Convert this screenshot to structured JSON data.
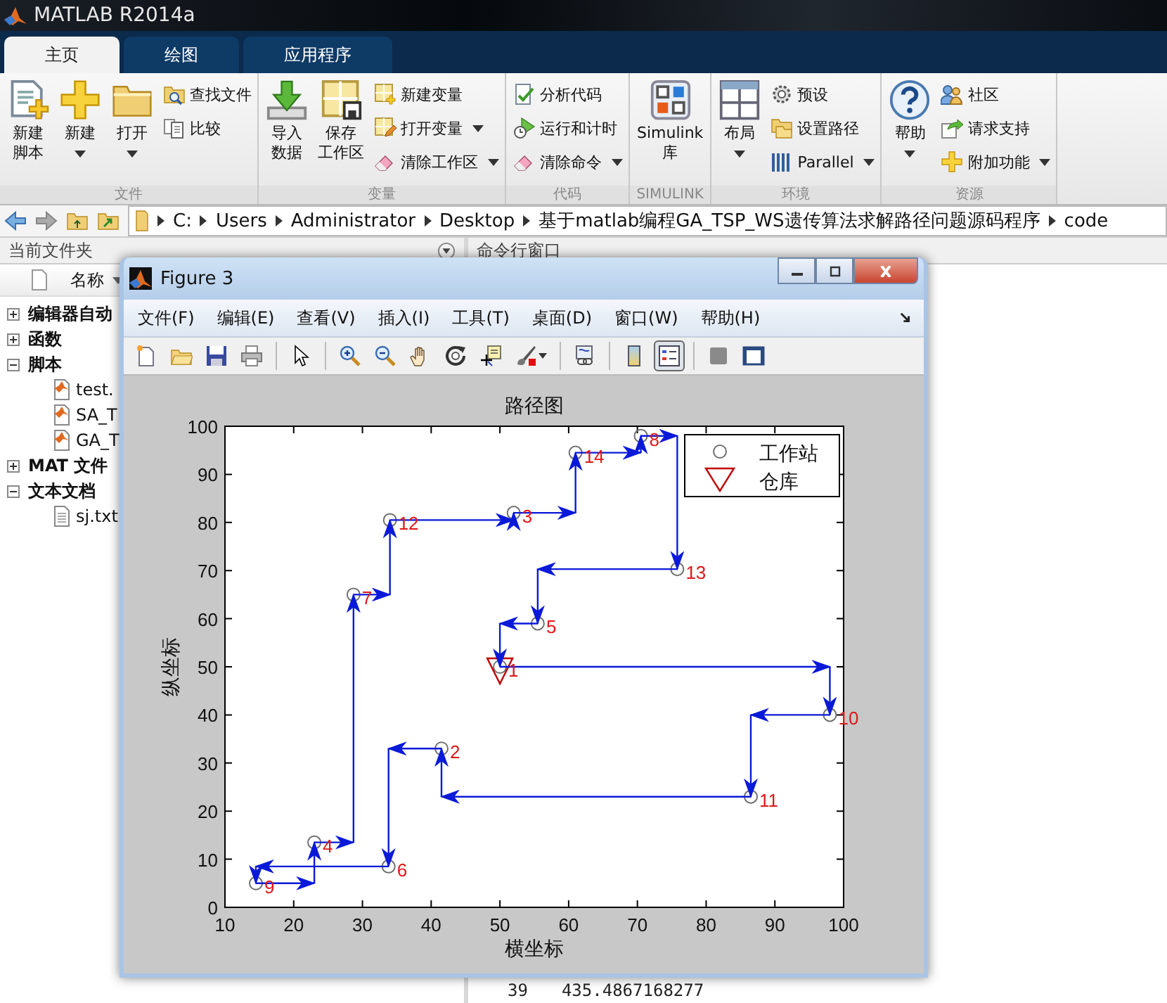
{
  "window": {
    "title": "MATLAB R2014a"
  },
  "ribbon_tabs": [
    {
      "label": "主页",
      "selected": true
    },
    {
      "label": "绘图",
      "selected": false
    },
    {
      "label": "应用程序",
      "selected": false
    }
  ],
  "ribbon_groups": [
    {
      "label": "文件",
      "large": [
        {
          "label": [
            "新建",
            "脚本"
          ],
          "dropdown": false
        },
        {
          "label": [
            "新建"
          ],
          "dropdown": true
        },
        {
          "label": [
            "打开"
          ],
          "dropdown": true
        }
      ],
      "small": [
        {
          "label": "查找文件",
          "dropdown": false
        },
        {
          "label": "比较",
          "dropdown": false
        }
      ]
    },
    {
      "label": "变量",
      "large": [
        {
          "label": [
            "导入",
            "数据"
          ],
          "dropdown": false
        },
        {
          "label": [
            "保存",
            "工作区"
          ],
          "dropdown": false
        }
      ],
      "small": [
        {
          "label": "新建变量",
          "dropdown": false
        },
        {
          "label": "打开变量",
          "dropdown": true
        },
        {
          "label": "清除工作区",
          "dropdown": true
        }
      ]
    },
    {
      "label": "代码",
      "small": [
        {
          "label": "分析代码",
          "dropdown": false
        },
        {
          "label": "运行和计时",
          "dropdown": false
        },
        {
          "label": "清除命令",
          "dropdown": true
        }
      ]
    },
    {
      "label": "SIMULINK",
      "large": [
        {
          "label": [
            "Simulink",
            "库"
          ],
          "dropdown": false
        }
      ]
    },
    {
      "label": "环境",
      "large": [
        {
          "label": [
            "布局"
          ],
          "dropdown": true
        }
      ],
      "small": [
        {
          "label": "预设",
          "dropdown": false
        },
        {
          "label": "设置路径",
          "dropdown": false
        },
        {
          "label": "Parallel",
          "dropdown": true
        }
      ]
    },
    {
      "label": "资源",
      "large": [
        {
          "label": [
            "帮助"
          ],
          "dropdown": true
        }
      ],
      "small": [
        {
          "label": "社区",
          "dropdown": false
        },
        {
          "label": "请求支持",
          "dropdown": false
        },
        {
          "label": "附加功能",
          "dropdown": true
        }
      ]
    }
  ],
  "address_bar": {
    "path": [
      "C:",
      "Users",
      "Administrator",
      "Desktop",
      "基于matlab编程GA_TSP_WS遗传算法求解路径问题源码程序",
      "code"
    ]
  },
  "current_folder": {
    "title": "当前文件夹",
    "column": "名称",
    "tree": [
      {
        "label": "编辑器自动",
        "expanded": false
      },
      {
        "label": "函数",
        "expanded": false
      },
      {
        "label": "脚本",
        "expanded": true,
        "children": [
          {
            "label": "test.",
            "kind": "script"
          },
          {
            "label": "SA_T",
            "kind": "script"
          },
          {
            "label": "GA_T",
            "kind": "script"
          }
        ]
      },
      {
        "label": "MAT 文件",
        "expanded": false
      },
      {
        "label": "文本文档",
        "expanded": true,
        "children": [
          {
            "label": "sj.txt",
            "kind": "text"
          }
        ]
      }
    ]
  },
  "command_window": {
    "title": "命令行窗口",
    "output": [
      [
        "39",
        "435.4867168277"
      ]
    ]
  },
  "figure": {
    "title": "Figure 3",
    "menus": [
      "文件(F)",
      "编辑(E)",
      "查看(V)",
      "插入(I)",
      "工具(T)",
      "桌面(D)",
      "窗口(W)",
      "帮助(H)"
    ],
    "toolbar": [
      {
        "kind": "new",
        "pressed": false
      },
      {
        "kind": "open",
        "pressed": false
      },
      {
        "kind": "save",
        "pressed": false
      },
      {
        "kind": "print",
        "pressed": false
      },
      {
        "kind": "separator"
      },
      {
        "kind": "pointer",
        "pressed": false
      },
      {
        "kind": "separator"
      },
      {
        "kind": "zoom-in",
        "pressed": false
      },
      {
        "kind": "zoom-out",
        "pressed": false
      },
      {
        "kind": "pan",
        "pressed": false
      },
      {
        "kind": "rotate",
        "pressed": false
      },
      {
        "kind": "data-cursor",
        "pressed": false
      },
      {
        "kind": "brush",
        "pressed": false
      },
      {
        "kind": "separator"
      },
      {
        "kind": "link",
        "pressed": false
      },
      {
        "kind": "separator"
      },
      {
        "kind": "colorbar",
        "pressed": false
      },
      {
        "kind": "legend",
        "pressed": true
      },
      {
        "kind": "separator"
      },
      {
        "kind": "hide-tools",
        "pressed": false
      },
      {
        "kind": "show-tools",
        "pressed": false
      }
    ],
    "chart_data": {
      "type": "scatter",
      "title": "路径图",
      "xlabel": "横坐标",
      "ylabel": "纵坐标",
      "xlim": [
        10,
        100
      ],
      "ylim": [
        0,
        100
      ],
      "xticks": [
        10,
        20,
        30,
        40,
        50,
        60,
        70,
        80,
        90,
        100
      ],
      "yticks": [
        0,
        10,
        20,
        30,
        40,
        50,
        60,
        70,
        80,
        90,
        100
      ],
      "legend": true,
      "series": [
        {
          "name": "工作站",
          "color": "#707070",
          "x": [
            50,
            41.5,
            52,
            23,
            55.5,
            33.8,
            28.7,
            70.5,
            14.5,
            98,
            86.5,
            34,
            75.8,
            61
          ],
          "values": [
            50,
            33,
            82,
            13.5,
            59,
            8.5,
            65,
            98,
            5,
            40,
            23,
            80.5,
            70.3,
            94.5
          ]
        },
        {
          "name": "仓库",
          "color": "#c00000",
          "x": [
            50
          ],
          "values": [
            50
          ]
        },
        {
          "type": "line",
          "color": "#0a1ad8",
          "x": [
            50,
            98,
            98,
            86.5,
            86.5,
            41.5,
            41.5,
            33.8,
            33.8,
            14.5,
            14.5,
            23,
            23,
            28.7,
            28.7,
            34,
            34,
            52,
            52,
            61,
            61,
            70.5,
            70.5,
            75.8,
            75.8,
            55.5,
            55.5,
            50,
            50
          ],
          "values": [
            50,
            50,
            40,
            40,
            23,
            23,
            33,
            33,
            8.5,
            8.5,
            5,
            5,
            13.5,
            13.5,
            65,
            65,
            80.5,
            80.5,
            82,
            82,
            94.5,
            94.5,
            98,
            98,
            70.3,
            70.3,
            59,
            59,
            50
          ]
        }
      ],
      "annotations": [
        {
          "x": 50,
          "y": 50,
          "text": "1"
        },
        {
          "x": 41.5,
          "y": 33,
          "text": "2"
        },
        {
          "x": 52,
          "y": 82,
          "text": "3"
        },
        {
          "x": 23,
          "y": 13.5,
          "text": "4"
        },
        {
          "x": 55.5,
          "y": 59,
          "text": "5"
        },
        {
          "x": 33.8,
          "y": 8.5,
          "text": "6"
        },
        {
          "x": 28.7,
          "y": 65,
          "text": "7"
        },
        {
          "x": 70.5,
          "y": 98,
          "text": "8"
        },
        {
          "x": 14.5,
          "y": 5,
          "text": "9"
        },
        {
          "x": 98,
          "y": 40,
          "text": "10"
        },
        {
          "x": 86.5,
          "y": 23,
          "text": "11"
        },
        {
          "x": 34,
          "y": 80.5,
          "text": "12"
        },
        {
          "x": 75.8,
          "y": 70.3,
          "text": "13"
        },
        {
          "x": 61,
          "y": 94.5,
          "text": "14"
        }
      ]
    }
  }
}
